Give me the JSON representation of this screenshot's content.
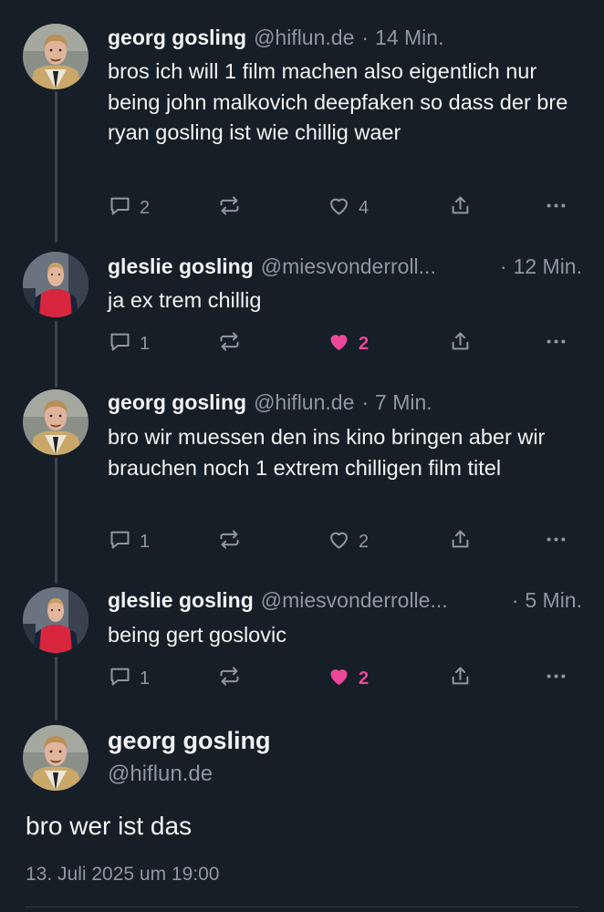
{
  "colors": {
    "background": "#161e27",
    "text": "#f1f3f5",
    "muted": "#8d98a5",
    "thread_line": "#3b4653",
    "like_active": "#ec4899"
  },
  "thread": [
    {
      "author": "georg gosling",
      "handle": "@hiflun.de",
      "separator": "·",
      "time": "14 Min.",
      "text": "bros ich will 1 film machen also eigentlich nur being john malkovich deepfaken so dass der bre ryan gosling ist wie chillig waer",
      "replies": "2",
      "reposts": "",
      "likes": "4",
      "liked": false,
      "icons": [
        "reply-icon",
        "repost-icon",
        "heart-outline-icon",
        "share-icon",
        "more-icon"
      ]
    },
    {
      "author": "gleslie gosling",
      "handle": "@miesvonderroll...",
      "separator": "·",
      "time": "12 Min.",
      "text": "ja ex trem chillig",
      "replies": "1",
      "reposts": "",
      "likes": "2",
      "liked": true,
      "icons": [
        "reply-icon",
        "repost-icon",
        "heart-filled-icon",
        "share-icon",
        "more-icon"
      ]
    },
    {
      "author": "georg gosling",
      "handle": "@hiflun.de",
      "separator": "·",
      "time": "7 Min.",
      "text": "bro wir muessen den ins kino bringen aber wir brauchen noch 1 extrem chilligen film titel",
      "replies": "1",
      "reposts": "",
      "likes": "2",
      "liked": false,
      "icons": [
        "reply-icon",
        "repost-icon",
        "heart-outline-icon",
        "share-icon",
        "more-icon"
      ]
    },
    {
      "author": "gleslie gosling",
      "handle": "@miesvonderrolle...",
      "separator": "·",
      "time": "5 Min.",
      "text": "being gert goslovic",
      "replies": "1",
      "reposts": "",
      "likes": "2",
      "liked": true,
      "icons": [
        "reply-icon",
        "repost-icon",
        "heart-filled-icon",
        "share-icon",
        "more-icon"
      ]
    }
  ],
  "main_post": {
    "author": "georg gosling",
    "handle": "@hiflun.de",
    "text": "bro wer ist das",
    "date": "13. Juli 2025 um 19:00"
  }
}
